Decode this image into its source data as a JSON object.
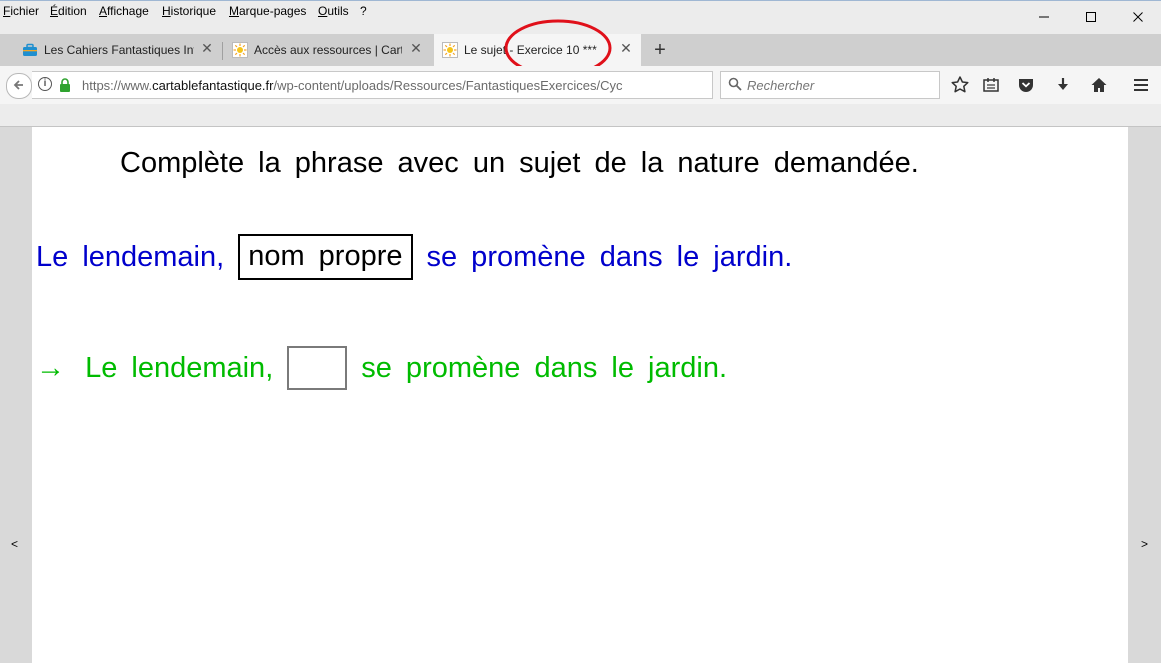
{
  "menubar": {
    "items": [
      "Fichier",
      "Édition",
      "Affichage",
      "Historique",
      "Marque-pages",
      "Outils",
      "?"
    ]
  },
  "window_controls": {
    "minimize": "—",
    "maximize": "☐",
    "close": "✕"
  },
  "tabs": [
    {
      "label": "Les Cahiers Fantastiques Inte",
      "icon": "briefcase-icon",
      "active": false
    },
    {
      "label": "Accès aux ressources | Cartal",
      "icon": "sun-icon",
      "active": false
    },
    {
      "label": "Le sujet - Exercice 10 ***",
      "icon": "sun-icon",
      "active": true
    }
  ],
  "new_tab": "+",
  "navbar": {
    "url_host_prefix": "https://www.",
    "url_host": "cartablefantastique.fr",
    "url_path": "/wp-content/uploads/Ressources/FantastiquesExercices/Cyc",
    "search_placeholder": "Rechercher"
  },
  "page": {
    "prev_arrow": "<",
    "next_arrow": ">",
    "instruction": "Complète la phrase avec un sujet de la nature demandée.",
    "sentence": {
      "before": "Le lendemain,",
      "nature": "nom propre",
      "after": "se promène dans le jardin."
    },
    "answer": {
      "arrow": "→",
      "before": "Le lendemain,",
      "value": "",
      "after": "se promène dans le jardin."
    }
  },
  "colors": {
    "sentence_color": "#0000cc",
    "answer_color": "#00bb00",
    "annotation_circle": "#e0101a"
  }
}
